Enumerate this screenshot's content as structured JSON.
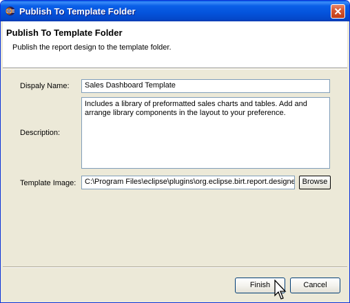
{
  "window": {
    "title": "Publish To Template Folder",
    "app_icon": "eclipse-icon",
    "close_icon": "close-icon"
  },
  "header": {
    "title": "Publish To Template Folder",
    "description": "Publish the report design to the template folder."
  },
  "form": {
    "display_name_label": "Dispaly Name:",
    "display_name_value": "Sales Dashboard Template",
    "description_label": "Description:",
    "description_value": "Includes a library of preformatted sales charts and tables. Add and arrange library components in the layout to your preference.",
    "template_image_label": "Template Image:",
    "template_image_value": "C:\\Program Files\\eclipse\\plugins\\org.eclipse.birt.report.designer",
    "browse_label": "Browse"
  },
  "footer": {
    "finish_label": "Finish",
    "cancel_label": "Cancel"
  },
  "colors": {
    "titlebar": "#0453db",
    "dialog_bg": "#ece9d8",
    "close_button": "#c13d17"
  }
}
